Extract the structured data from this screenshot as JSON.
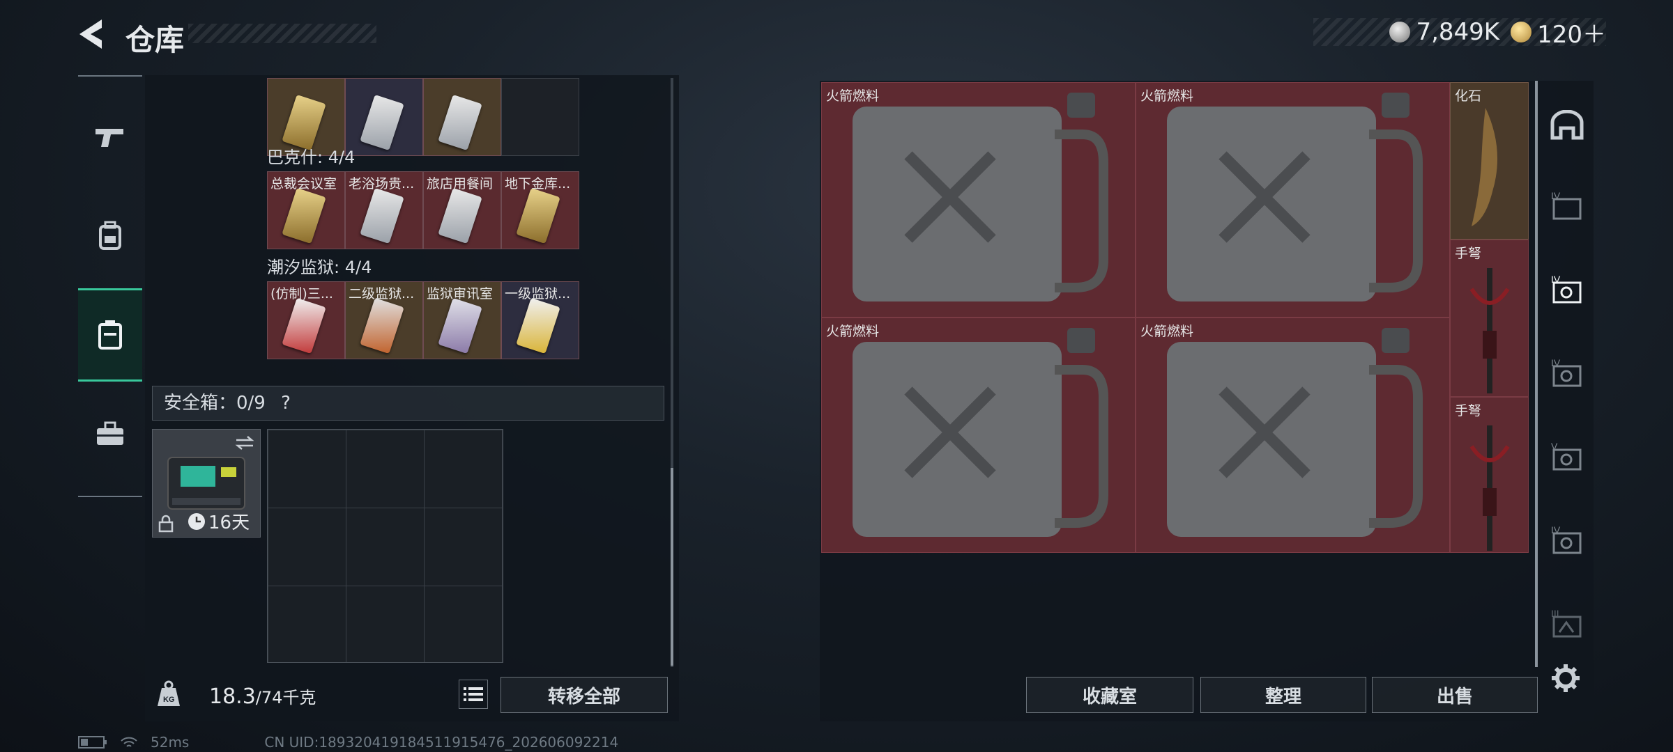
{
  "header": {
    "title": "仓库"
  },
  "currency": {
    "silver": "7,849K",
    "gold": "120＋"
  },
  "left_tabs": [
    {
      "name": "pistol"
    },
    {
      "name": "backpack"
    },
    {
      "name": "container"
    },
    {
      "name": "toolbox"
    }
  ],
  "keycards": {
    "top_row": [
      {
        "label": ""
      },
      {
        "label": ""
      },
      {
        "label": ""
      },
      {
        "label": ""
      }
    ],
    "group1": {
      "title": "巴克什: 4/4",
      "cards": [
        {
          "label": "总裁会议室"
        },
        {
          "label": "老浴场贵..."
        },
        {
          "label": "旅店用餐间"
        },
        {
          "label": "地下金库..."
        }
      ]
    },
    "group2": {
      "title": "潮汐监狱: 4/4",
      "cards": [
        {
          "label": "(仿制)三..."
        },
        {
          "label": "二级监狱..."
        },
        {
          "label": "监狱审讯室"
        },
        {
          "label": "一级监狱..."
        }
      ]
    }
  },
  "safe_box": {
    "label": "安全箱：0/9",
    "help": "?",
    "duration": "16天"
  },
  "weight": {
    "current": "18.3",
    "capacity": "/74千克"
  },
  "buttons": {
    "transfer_all": "转移全部",
    "collection": "收藏室",
    "sort": "整理",
    "sell": "出售"
  },
  "stash": {
    "items": [
      {
        "label": "火箭燃料"
      },
      {
        "label": "火箭燃料"
      },
      {
        "label": "化石"
      },
      {
        "label": "手弩"
      },
      {
        "label": "火箭燃料"
      },
      {
        "label": "火箭燃料"
      },
      {
        "label": "手弩"
      }
    ]
  },
  "status": {
    "ping": "52ms",
    "uid": "CN UID:18932041918451191​5476_202606092214"
  }
}
